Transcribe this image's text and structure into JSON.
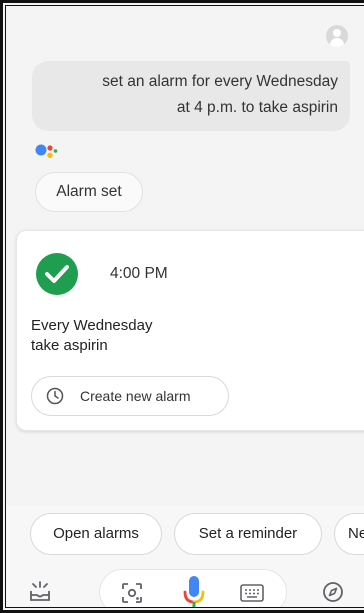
{
  "conversation": {
    "user_query_line1": "set an alarm for every Wednesday",
    "user_query_line2": "at 4 p.m. to take aspirin",
    "assistant_reply": "Alarm set"
  },
  "alarm_card": {
    "time": "4:00 PM",
    "repeat": "Every Wednesday",
    "label": "take aspirin",
    "create_button": "Create new alarm"
  },
  "suggestions": [
    "Open alarms",
    "Set a reminder",
    "Ne"
  ],
  "colors": {
    "check_green": "#1e9e4e",
    "mic_blue": "#4285f4",
    "mic_red": "#ea4335",
    "mic_yellow": "#fbbc05",
    "mic_green": "#34a853"
  },
  "icons": {
    "avatar": "account-avatar-icon",
    "assistant_logo": "google-assistant-logo",
    "check": "check-circle-icon",
    "clock": "clock-icon",
    "updates": "updates-tray-icon",
    "lens": "lens-icon",
    "mic": "mic-icon",
    "keyboard": "keyboard-icon",
    "explore": "explore-compass-icon"
  }
}
